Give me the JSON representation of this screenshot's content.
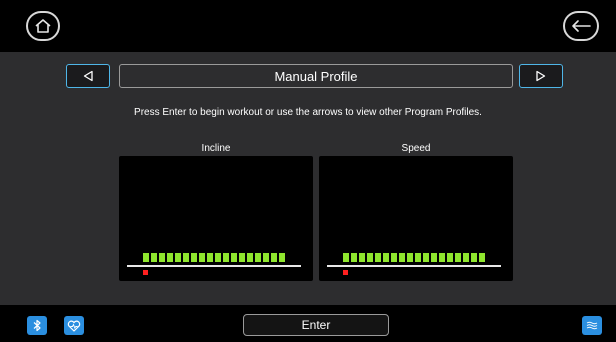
{
  "header": {
    "home_icon": "home-icon",
    "back_icon": "back-arrow-icon"
  },
  "profile": {
    "title": "Manual Profile",
    "prev_icon": "triangle-left-icon",
    "next_icon": "triangle-right-icon",
    "instructions": "Press Enter to begin workout or use the arrows to view other Program Profiles."
  },
  "panels": {
    "incline": {
      "label": "Incline",
      "segment_count": 18,
      "marker_position": 1
    },
    "speed": {
      "label": "Speed",
      "segment_count": 18,
      "marker_position": 1
    }
  },
  "footer": {
    "enter_label": "Enter",
    "bluetooth_icon": "bluetooth-icon",
    "heart_rate_icon": "heart-rate-icon",
    "fan_icon": "fan-icon"
  },
  "colors": {
    "accent": "#2b8fe0",
    "bar": "#8fe62e",
    "marker": "#ff2020"
  }
}
